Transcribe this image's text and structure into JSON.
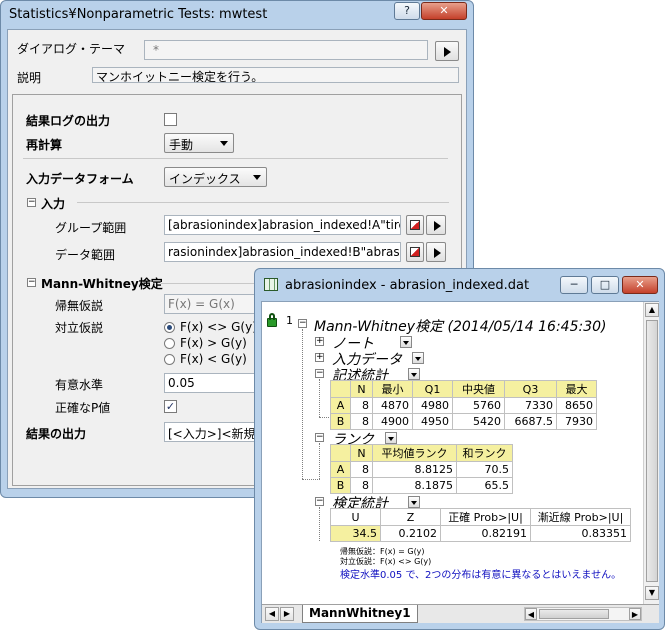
{
  "dialog": {
    "title": "Statistics¥Nonparametric Tests: mwtest",
    "help_btn": "?",
    "close_btn": "✕",
    "theme_label": "ダイアログ・テーマ",
    "theme_value": "*",
    "desc_label": "説明",
    "desc_value": "マンホイットニー検定を行う。",
    "log_label": "結果ログの出力",
    "recalc_label": "再計算",
    "recalc_value": "手動",
    "input_form_label": "入力データフォーム",
    "input_form_value": "インデックス",
    "input_group": "入力",
    "group_range_label": "グループ範囲",
    "group_range_value": "[abrasionindex]abrasion_indexed!A\"tire\"",
    "data_range_label": "データ範囲",
    "data_range_value": "rasionindex]abrasion_indexed!B\"abrasion\"",
    "mw_group": "Mann-Whitney検定",
    "null_label": "帰無仮説",
    "null_value": "F(x) = G(x)",
    "alt_label": "対立仮説",
    "alt_options": [
      "F(x) <> G(y)",
      "F(x) > G(y)",
      "F(x) < G(y)"
    ],
    "alpha_label": "有意水準",
    "alpha_value": "0.05",
    "exact_label": "正確なP値",
    "output_label": "結果の出力",
    "output_value": "[<入力>]<新規>"
  },
  "report": {
    "title": "abrasionindex - abrasion_indexed.dat",
    "row_number": "1",
    "main_title": "Mann-Whitney検定 (2014/05/14 16:45:30)",
    "nodes": [
      "ノート",
      "入力データ",
      "記述統計",
      "ランク",
      "検定統計"
    ],
    "desc_table": {
      "headers": [
        "",
        "N",
        "最小",
        "Q1",
        "中央値",
        "Q3",
        "最大"
      ],
      "rows": [
        [
          "A",
          "8",
          "4870",
          "4980",
          "5760",
          "7330",
          "8650"
        ],
        [
          "B",
          "8",
          "4900",
          "4950",
          "5420",
          "6687.5",
          "7930"
        ]
      ]
    },
    "rank_table": {
      "headers": [
        "",
        "N",
        "平均値ランク",
        "和ランク"
      ],
      "rows": [
        [
          "A",
          "8",
          "8.8125",
          "70.5"
        ],
        [
          "B",
          "8",
          "8.1875",
          "65.5"
        ]
      ]
    },
    "test_table": {
      "headers": [
        "U",
        "Z",
        "正確 Prob>|U|",
        "漸近線 Prob>|U|"
      ],
      "rows": [
        [
          "34.5",
          "0.2102",
          "0.82191",
          "0.83351"
        ]
      ]
    },
    "null_note": "帰無仮説：F(x) = G(y)",
    "alt_note": "対立仮説：F(x) <> G(y)",
    "conclusion": "検定水準0.05 で、2つの分布は有意に異なるとはいえません。",
    "sheet_tab": "MannWhitney1",
    "min_btn": "─",
    "max_btn": "□",
    "close_btn": "✕"
  }
}
